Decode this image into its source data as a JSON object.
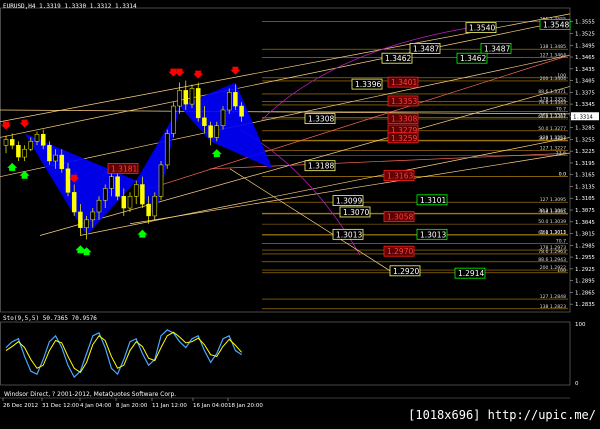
{
  "header": {
    "title": "EURUSD,H4 1.3319 1.3330 1.3312 1.3314"
  },
  "oscillator": {
    "title": "Sto(9,5,5) 50.7365 70.9576"
  },
  "copyright": "Windsor Direct, ? 2001-2012, MetaQuotes Software Corp.",
  "watermark": "[1018x696] http://upic.me/",
  "colors": {
    "bg": "#000000",
    "bull": "#00ff00",
    "bear": "#ff0000",
    "pattern": "#0000ff",
    "fib": "#b8860b",
    "gann": "#ffd27f",
    "osc_main": "#4da6ff",
    "osc_signal": "#ffff00"
  },
  "chart_data": {
    "type": "candlestick",
    "price_axis": {
      "ylim": [
        1.2815,
        1.359
      ],
      "ticks": [
        "1.3555",
        "1.3525",
        "1.3495",
        "1.3465",
        "1.3435",
        "1.3405",
        "1.3375",
        "1.3345",
        "1.3314",
        "1.3285",
        "1.3255",
        "1.3225",
        "1.3195",
        "1.3165",
        "1.3135",
        "1.3105",
        "1.3075",
        "1.3045",
        "1.3015",
        "1.2985",
        "1.2955",
        "1.2925",
        "1.2895",
        "1.2865",
        "1.2835"
      ],
      "current": "1.3314"
    },
    "x_ticks": [
      "26 Dec 2012",
      "31 Dec 12:00",
      "4 Jan 04:00",
      "8 Jan 20:00",
      "11 Jan 12:00",
      "16 Jan 04:00",
      "18 Jan 20:00"
    ],
    "osc_ticks": [
      "100",
      "0"
    ],
    "boxes": [
      {
        "label": "1.3540",
        "price": 1.354,
        "style": "yellow"
      },
      {
        "label": "1.3548",
        "price": 1.3548,
        "style": "green"
      },
      {
        "label": "1.3487",
        "price": 1.3487,
        "style": "yellow"
      },
      {
        "label": "1.3487",
        "price": 1.3487,
        "style": "green"
      },
      {
        "label": "1.3462",
        "price": 1.3462,
        "style": "yellow"
      },
      {
        "label": "1.3462",
        "price": 1.3462,
        "style": "green"
      },
      {
        "label": "1.3396",
        "price": 1.3396,
        "style": "yellow"
      },
      {
        "label": "1.3401",
        "price": 1.3401,
        "style": "red"
      },
      {
        "label": "1.3353",
        "price": 1.3353,
        "style": "red"
      },
      {
        "label": "1.3308",
        "price": 1.3308,
        "style": "yellow"
      },
      {
        "label": "1.3308",
        "price": 1.3308,
        "style": "red"
      },
      {
        "label": "1.3279",
        "price": 1.3279,
        "style": "red"
      },
      {
        "label": "1.3259",
        "price": 1.3259,
        "style": "red"
      },
      {
        "label": "1.3188",
        "price": 1.3188,
        "style": "yellow"
      },
      {
        "label": "1.3181",
        "price": 1.3181,
        "style": "red"
      },
      {
        "label": "1.3163",
        "price": 1.3163,
        "style": "red"
      },
      {
        "label": "1.3099",
        "price": 1.3099,
        "style": "yellow"
      },
      {
        "label": "1.3101",
        "price": 1.3101,
        "style": "green"
      },
      {
        "label": "1.3070",
        "price": 1.307,
        "style": "yellow"
      },
      {
        "label": "1.3058",
        "price": 1.3058,
        "style": "red"
      },
      {
        "label": "1.3013",
        "price": 1.3013,
        "style": "yellow"
      },
      {
        "label": "1.3013",
        "price": 1.3013,
        "style": "green"
      },
      {
        "label": "1.2970",
        "price": 1.297,
        "style": "red"
      },
      {
        "label": "1.2920",
        "price": 1.292,
        "style": "yellow"
      },
      {
        "label": "1.2914",
        "price": 1.2914,
        "style": "green"
      }
    ],
    "fib_labels": [
      {
        "text": "261 1.3555",
        "price": 1.3555
      },
      {
        "text": "138 1.3485",
        "price": 1.3485
      },
      {
        "text": "127 1.3464",
        "price": 1.3464
      },
      {
        "text": "100",
        "price": 1.3412
      },
      {
        "text": "200 1.3404",
        "price": 1.3404
      },
      {
        "text": "88.6 1.3371",
        "price": 1.3371
      },
      {
        "text": "178 1.3352",
        "price": 1.3352
      },
      {
        "text": "78.6 1.3343",
        "price": 1.3343
      },
      {
        "text": "70.7",
        "price": 1.3326
      },
      {
        "text": "161 1.3311",
        "price": 1.3311
      },
      {
        "text": "61.8 1.3307",
        "price": 1.3307
      },
      {
        "text": "50.0 1.3277",
        "price": 1.3277
      },
      {
        "text": "138 1.3253",
        "price": 1.3253
      },
      {
        "text": "38.2 1.3251",
        "price": 1.3251
      },
      {
        "text": "127 1.3227",
        "price": 1.3227
      },
      {
        "text": "23.6",
        "price": 1.3214
      },
      {
        "text": "0.0",
        "price": 1.316
      },
      {
        "text": "0.0",
        "price": 1.316
      },
      {
        "text": "127 1.3095",
        "price": 1.3095
      },
      {
        "text": "138 1.3065",
        "price": 1.3065
      },
      {
        "text": "38.2 1.3067",
        "price": 1.3067
      },
      {
        "text": "50.0 1.3039",
        "price": 1.3039
      },
      {
        "text": "161 1.3013",
        "price": 1.3013
      },
      {
        "text": "61.8 1.3011",
        "price": 1.3011
      },
      {
        "text": "70.7",
        "price": 1.299
      },
      {
        "text": "178 1.2973",
        "price": 1.2973
      },
      {
        "text": "78.6 1.2963",
        "price": 1.2963
      },
      {
        "text": "88.6 1.2943",
        "price": 1.2943
      },
      {
        "text": "200 1.2922",
        "price": 1.2922
      },
      {
        "text": "100",
        "price": 1.2915
      },
      {
        "text": "127 1.2848",
        "price": 1.2848
      },
      {
        "text": "138 1.2823",
        "price": 1.2823
      }
    ],
    "candles": [
      [
        1.324,
        1.3265,
        1.322,
        1.3255
      ],
      [
        1.3255,
        1.327,
        1.323,
        1.324
      ],
      [
        1.324,
        1.325,
        1.32,
        1.321
      ],
      [
        1.321,
        1.324,
        1.32,
        1.323
      ],
      [
        1.323,
        1.326,
        1.3225,
        1.325
      ],
      [
        1.325,
        1.3275,
        1.324,
        1.3268
      ],
      [
        1.3268,
        1.328,
        1.323,
        1.324
      ],
      [
        1.324,
        1.325,
        1.319,
        1.32
      ],
      [
        1.32,
        1.323,
        1.318,
        1.3215
      ],
      [
        1.3215,
        1.323,
        1.317,
        1.318
      ],
      [
        1.318,
        1.3195,
        1.311,
        1.312
      ],
      [
        1.312,
        1.314,
        1.306,
        1.307
      ],
      [
        1.307,
        1.309,
        1.301,
        1.303
      ],
      [
        1.303,
        1.306,
        1.3,
        1.305
      ],
      [
        1.305,
        1.308,
        1.303,
        1.307
      ],
      [
        1.307,
        1.311,
        1.305,
        1.31
      ],
      [
        1.31,
        1.314,
        1.308,
        1.313
      ],
      [
        1.313,
        1.317,
        1.311,
        1.316
      ],
      [
        1.316,
        1.3175,
        1.31,
        1.311
      ],
      [
        1.311,
        1.313,
        1.306,
        1.308
      ],
      [
        1.308,
        1.312,
        1.307,
        1.311
      ],
      [
        1.311,
        1.315,
        1.309,
        1.314
      ],
      [
        1.314,
        1.316,
        1.308,
        1.309
      ],
      [
        1.309,
        1.311,
        1.304,
        1.306
      ],
      [
        1.306,
        1.312,
        1.305,
        1.311
      ],
      [
        1.311,
        1.32,
        1.31,
        1.319
      ],
      [
        1.319,
        1.328,
        1.318,
        1.327
      ],
      [
        1.327,
        1.335,
        1.326,
        1.334
      ],
      [
        1.334,
        1.34,
        1.332,
        1.338
      ],
      [
        1.338,
        1.3405,
        1.333,
        1.3345
      ],
      [
        1.3345,
        1.3395,
        1.3335,
        1.3385
      ],
      [
        1.3385,
        1.34,
        1.33,
        1.331
      ],
      [
        1.331,
        1.334,
        1.327,
        1.329
      ],
      [
        1.329,
        1.33,
        1.324,
        1.326
      ],
      [
        1.326,
        1.33,
        1.325,
        1.329
      ],
      [
        1.329,
        1.334,
        1.328,
        1.333
      ],
      [
        1.333,
        1.3385,
        1.332,
        1.3375
      ],
      [
        1.3375,
        1.3395,
        1.333,
        1.334
      ],
      [
        1.334,
        1.335,
        1.33,
        1.3314
      ]
    ],
    "arrows_down": [
      [
        0,
        1.3285
      ],
      [
        3,
        1.329
      ],
      [
        11,
        1.315
      ],
      [
        27,
        1.342
      ],
      [
        28,
        1.342
      ],
      [
        31,
        1.3415
      ],
      [
        37,
        1.3425
      ]
    ],
    "arrows_up": [
      [
        1,
        1.319
      ],
      [
        3,
        1.317
      ],
      [
        12,
        1.298
      ],
      [
        13,
        1.2975
      ],
      [
        22,
        1.302
      ],
      [
        34,
        1.3225
      ]
    ],
    "pattern_points": [
      [
        1.327,
        3
      ],
      [
        1.301,
        13
      ],
      [
        1.315,
        21
      ],
      [
        1.305,
        24
      ],
      [
        1.334,
        28
      ],
      [
        1.325,
        33
      ],
      [
        1.34,
        37
      ],
      [
        1.318,
        43
      ]
    ],
    "osc_main": [
      60,
      70,
      75,
      45,
      20,
      15,
      40,
      70,
      80,
      60,
      30,
      10,
      20,
      50,
      80,
      85,
      60,
      25,
      15,
      40,
      70,
      75,
      50,
      30,
      40,
      80,
      90,
      85,
      70,
      60,
      75,
      80,
      55,
      35,
      50,
      75,
      80,
      55,
      48
    ],
    "osc_signal": [
      55,
      62,
      70,
      60,
      40,
      25,
      30,
      55,
      72,
      68,
      45,
      25,
      18,
      35,
      65,
      80,
      72,
      45,
      25,
      30,
      55,
      70,
      62,
      42,
      38,
      60,
      80,
      86,
      78,
      68,
      70,
      76,
      65,
      48,
      45,
      62,
      74,
      64,
      52
    ]
  }
}
